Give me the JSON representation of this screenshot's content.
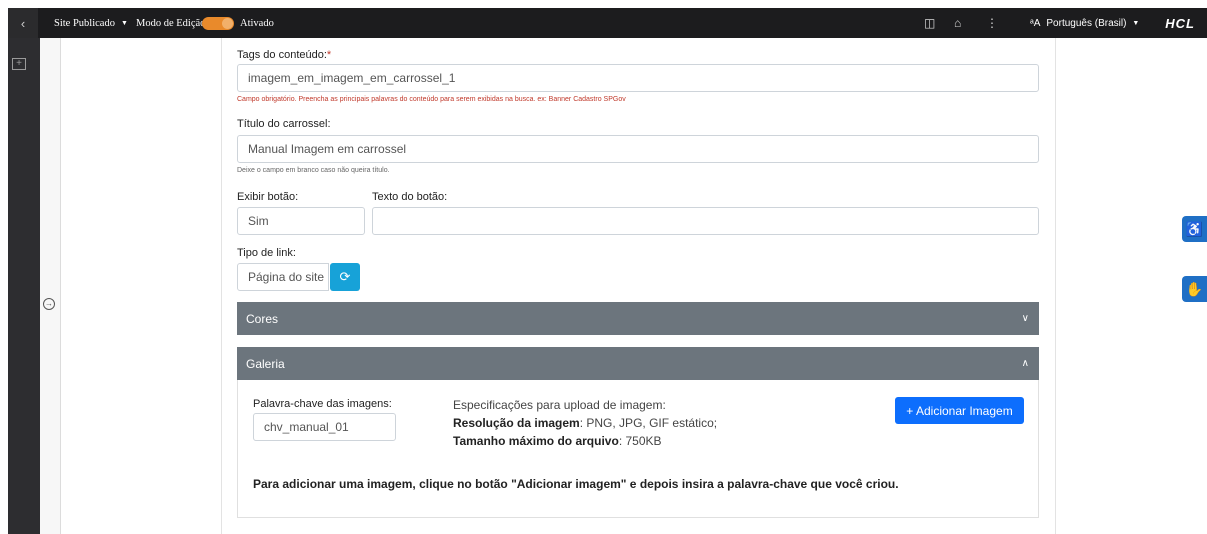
{
  "topbar": {
    "back_icon": "chevron-left-icon",
    "site_status": "Site Publicado",
    "edit_mode_label": "Modo de Edição:",
    "edit_mode_value": "Ativado",
    "language": "Português (Brasil)",
    "brand": "HCL",
    "accent_color": "#e98a2b"
  },
  "form": {
    "tags_label": "Tags do conteúdo:",
    "tags_required_mark": "*",
    "tags_value": "imagem_em_imagem_em_carrossel_1",
    "tags_hint": "Campo obrigatório. Preencha as principais palavras do conteúdo para serem exibidas na busca. ex: Banner Cadastro SPGov",
    "carousel_title_label": "Título do carrossel:",
    "carousel_title_value": "Manual Imagem em carrossel",
    "carousel_title_hint": "Deixe o campo em branco caso não queira título.",
    "show_button_label": "Exibir botão:",
    "show_button_value": "Sim",
    "button_text_label": "Texto do botão:",
    "button_text_value": "",
    "link_type_label": "Tipo de link:",
    "link_type_value": "Página do site"
  },
  "panels": {
    "colors_title": "Cores",
    "gallery_title": "Galeria",
    "header_color": "#6c757d"
  },
  "gallery": {
    "keyword_label": "Palavra-chave das imagens:",
    "keyword_value": "chv_manual_01",
    "spec_title": "Especificações para upload de imagem:",
    "resolution_label": "Resolução da imagem",
    "resolution_value": ": PNG, JPG, GIF estático;",
    "max_size_label": "Tamanho máximo do arquivo",
    "max_size_value": ": 750KB",
    "add_button_label": "+ Adicionar Imagem",
    "add_button_color": "#0d6efd",
    "instruction": "Para adicionar uma imagem, clique no botão \"Adicionar imagem\" e depois insira a palavra-chave que você criou."
  }
}
